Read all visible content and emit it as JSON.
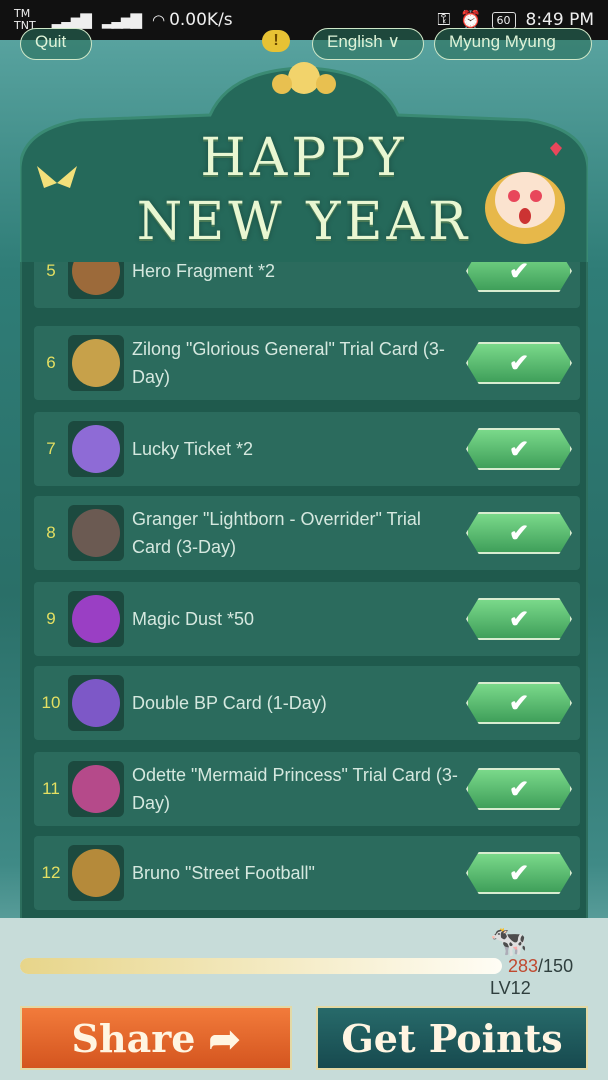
{
  "status_bar": {
    "carrier1": "TM",
    "carrier2": "TNT",
    "speed": "0.00K/s",
    "battery": "60",
    "time": "8:49 PM"
  },
  "header": {
    "quit_label": "Quit",
    "language_label": "English ∨",
    "user_label": "Myung Myung",
    "title_line1": "HAPPY",
    "title_line2": "NEW YEAR"
  },
  "rewards": [
    {
      "num": "5",
      "label": "Hero Fragment *2",
      "icon": "hero-fragment-icon",
      "color": "#9c6a3a",
      "claimed": true
    },
    {
      "num": "6",
      "label": "Zilong \"Glorious General\" Trial Card (3-Day)",
      "icon": "zilong-hero-icon",
      "color": "#c7a14a",
      "claimed": true
    },
    {
      "num": "7",
      "label": "Lucky Ticket *2",
      "icon": "lucky-ticket-icon",
      "color": "#8e6bd6",
      "claimed": true
    },
    {
      "num": "8",
      "label": "Granger \"Lightborn - Overrider\" Trial Card (3-Day)",
      "icon": "granger-hero-icon",
      "color": "#6b5a52",
      "claimed": true
    },
    {
      "num": "9",
      "label": "Magic Dust *50",
      "icon": "magic-dust-icon",
      "color": "#9a3fc4",
      "claimed": true
    },
    {
      "num": "10",
      "label": "Double BP Card (1-Day)",
      "icon": "bp-card-icon",
      "color": "#7d58c7",
      "claimed": true
    },
    {
      "num": "11",
      "label": "Odette \"Mermaid Princess\" Trial Card (3-Day)",
      "icon": "odette-hero-icon",
      "color": "#b54a8a",
      "claimed": true
    },
    {
      "num": "12",
      "label": "Bruno \"Street Football\"",
      "icon": "bruno-hero-icon",
      "color": "#b58a3a",
      "claimed": true
    }
  ],
  "claimed_mark": "✔",
  "footer": {
    "points_current": "283",
    "points_max": "/150",
    "progress_fraction": 1.0,
    "level": "LV12",
    "share_label": "Share ➦",
    "get_points_label": "Get Points"
  }
}
